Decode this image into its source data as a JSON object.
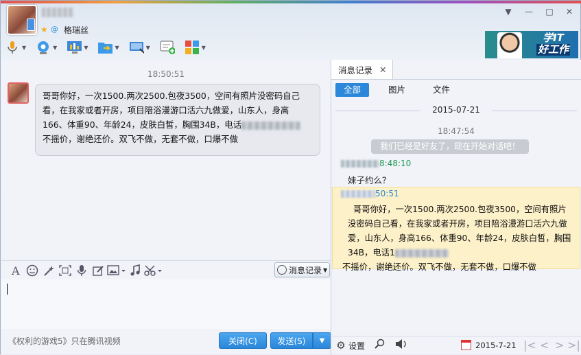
{
  "header": {
    "signature": "格瑞丝",
    "star_icon": "star-icon",
    "qq_icon": "qq-icon",
    "window_controls": [
      "▼",
      "—",
      "□",
      "✕"
    ]
  },
  "toolbar": {
    "items": [
      "microphone-icon",
      "webcam-icon",
      "screen-share-icon",
      "file-transfer-icon",
      "remote-desktop-icon",
      "message-add-icon",
      "apps-icon"
    ]
  },
  "ad": {
    "line1": "学IT",
    "line2": "好工作"
  },
  "chat": {
    "time": "18:50:51",
    "message_line1": "哥哥你好，一次1500.两次2500.包夜3500，空间有照片没密码自己看，在我家或者开房，项目陪浴漫游口活六九做爱，山东人，身高166、体重90、年龄24，皮肤白皙，胸围34B，电话",
    "message_line2": "不摇价，谢绝还价。双飞不做，无套不做，口爆不做"
  },
  "format_bar": {
    "items": [
      "font-icon",
      "emoji-icon",
      "magic-icon",
      "screenshot-icon",
      "voice-icon",
      "edit-icon",
      "image-icon",
      "music-icon",
      "scissors-icon"
    ],
    "history_label": "消息记录"
  },
  "bottom": {
    "promo": "《权利的游戏5》只在腾讯视频",
    "close_label": "关闭(C)",
    "send_label": "发送(S)",
    "send_dropdown": "▼"
  },
  "history": {
    "tab_label": "消息记录",
    "tab_close": "✕",
    "filters": [
      "全部",
      "图片",
      "文件"
    ],
    "date": "2015-07-21",
    "time": "18:47:54",
    "system_message": "我们已经是好友了，现在开始对话吧！",
    "sender1_time": "8:48:10",
    "msg1": "妹子约么？",
    "sender2_time": "50:51",
    "msg2_part1": "哥哥你好，一次1500.两次2500.包夜3500，空间有照片没密码自己看，在我家或者开房，项目陪浴漫游口活六九做爱，山东人，身高166、体重90、年龄24，皮肤白皙，胸围34B，电话1",
    "msg2_part2": "不摇价，谢绝还价。双飞不做，无套不做，口爆不做",
    "settings_label": "设置",
    "bottom_date": "2015-7-21",
    "nav": [
      "|<",
      "<",
      ">",
      ">|"
    ]
  }
}
